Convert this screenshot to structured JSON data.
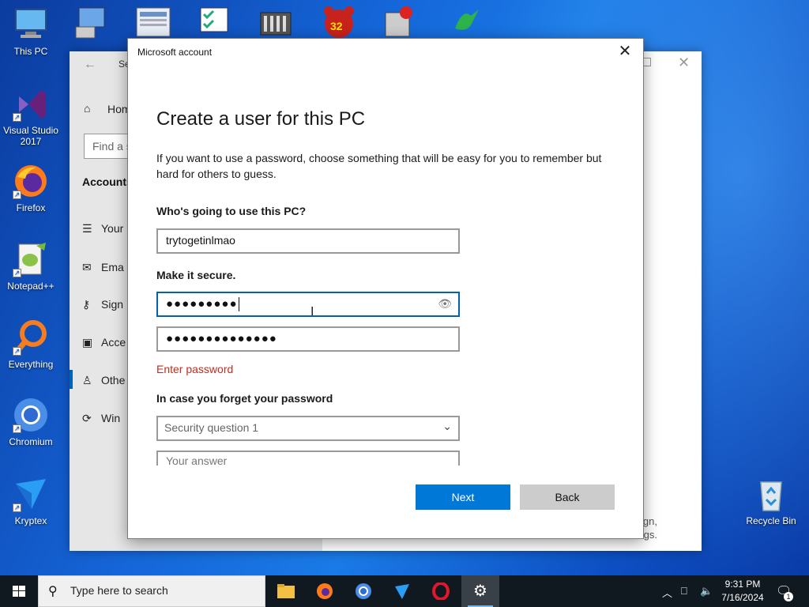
{
  "desktop": {
    "icons": [
      {
        "label": "This PC"
      },
      {
        "label": "Visual Studio 2017"
      },
      {
        "label": "Firefox"
      },
      {
        "label": "Notepad++"
      },
      {
        "label": "Everything"
      },
      {
        "label": "Chromium"
      },
      {
        "label": "Kryptex"
      }
    ],
    "top_row_badge": "32",
    "recycle_bin": "Recycle Bin"
  },
  "settings": {
    "title": "Se",
    "home": "Hom",
    "find_placeholder": "Find a s",
    "section": "Accounts",
    "nav": [
      {
        "icon": "user-info-icon",
        "label": "Your"
      },
      {
        "icon": "mail-icon",
        "label": "Ema"
      },
      {
        "icon": "key-icon",
        "label": "Sign"
      },
      {
        "icon": "briefcase-icon",
        "label": "Acce"
      },
      {
        "icon": "other-users-icon",
        "label": "Othe"
      },
      {
        "icon": "sync-icon",
        "label": "Win"
      }
    ],
    "bottom_text_line1": "gn,",
    "bottom_text_line2": "gs."
  },
  "dialog": {
    "window_title": "Microsoft account",
    "heading": "Create a user for this PC",
    "intro": "If you want to use a password, choose something that will be easy for you to remember but hard for others to guess.",
    "who_label": "Who's going to use this PC?",
    "username_value": "trytogetinlmao",
    "secure_label": "Make it secure.",
    "password_mask": "●●●●●●●●●",
    "reenter_mask": "●●●●●●●●●●●●●●",
    "error": "Enter password",
    "forget_label": "In case you forget your password",
    "security_question": "Security question 1",
    "answer_placeholder": "Your answer",
    "next": "Next",
    "back": "Back",
    "accent_color": "#0078d7",
    "error_color": "#c42b1c"
  },
  "taskbar": {
    "search_placeholder": "Type here to search",
    "time": "9:31 PM",
    "date": "7/16/2024",
    "notification_count": "1"
  }
}
